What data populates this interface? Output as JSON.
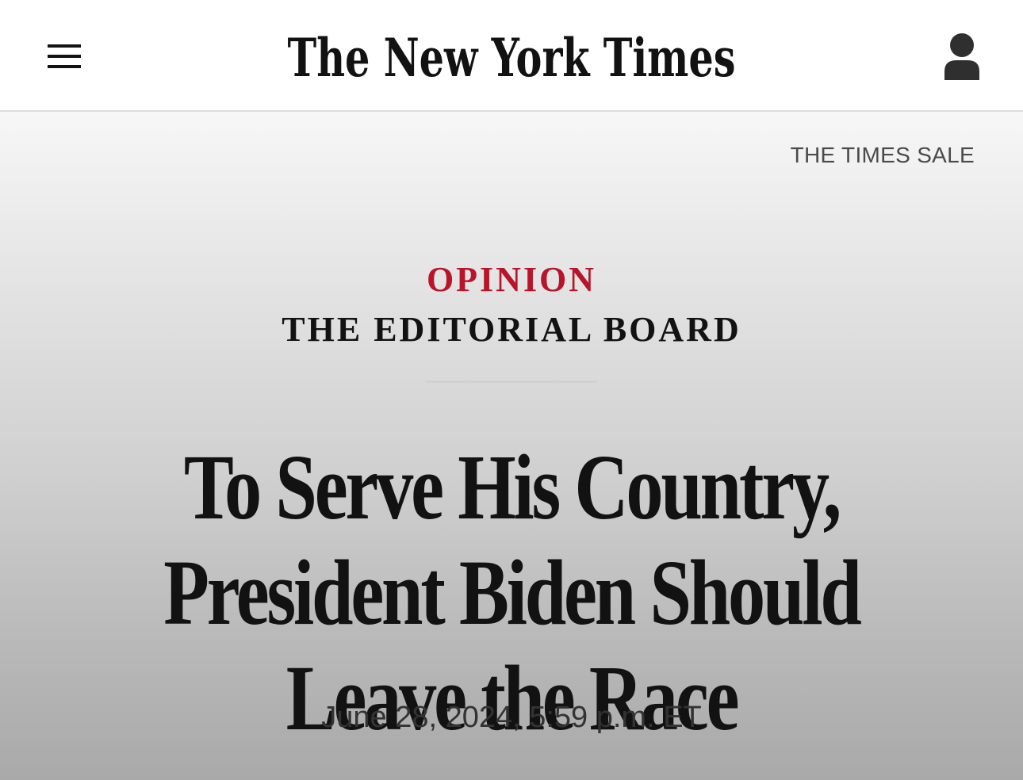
{
  "header": {
    "logo_text": "The New York Times",
    "menu_icon": "hamburger-menu-icon",
    "account_icon": "user-account-icon"
  },
  "promo": {
    "label": "THE TIMES SALE"
  },
  "article": {
    "section": "OPINION",
    "byline": "THE EDITORIAL BOARD",
    "headline": "To Serve His Country, President Biden Should Leave the Race",
    "timestamp": "June 28, 2024, 5:59 p.m. ET"
  },
  "colors": {
    "section_accent": "#b8142a",
    "text_primary": "#121212",
    "text_secondary": "#4a4a4a"
  }
}
